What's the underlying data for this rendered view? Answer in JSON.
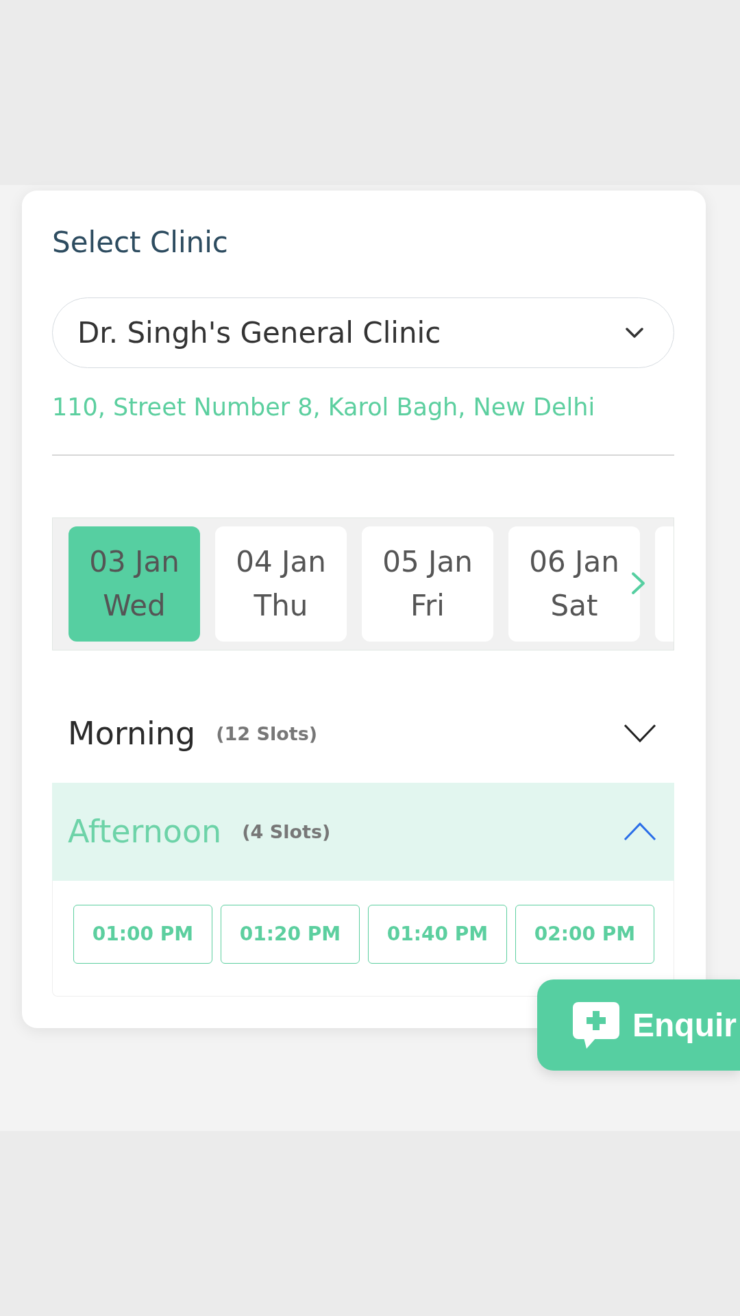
{
  "clinic_selector": {
    "label": "Select Clinic",
    "value": "Dr. Singh's General Clinic",
    "address": "110, Street Number 8, Karol Bagh, New Delhi"
  },
  "dates": [
    {
      "date": "03 Jan",
      "day": "Wed",
      "selected": true
    },
    {
      "date": "04 Jan",
      "day": "Thu",
      "selected": false
    },
    {
      "date": "05 Jan",
      "day": "Fri",
      "selected": false
    },
    {
      "date": "06 Jan",
      "day": "Sat",
      "selected": false
    }
  ],
  "sessions": [
    {
      "name": "Morning",
      "count": "(12 Slots)",
      "expanded": false
    },
    {
      "name": "Afternoon",
      "count": "(4 Slots)",
      "expanded": true,
      "slots": [
        "01:00 PM",
        "01:20 PM",
        "01:40 PM",
        "02:00 PM"
      ]
    }
  ],
  "enquiry_button": {
    "label": "Enquir"
  }
}
